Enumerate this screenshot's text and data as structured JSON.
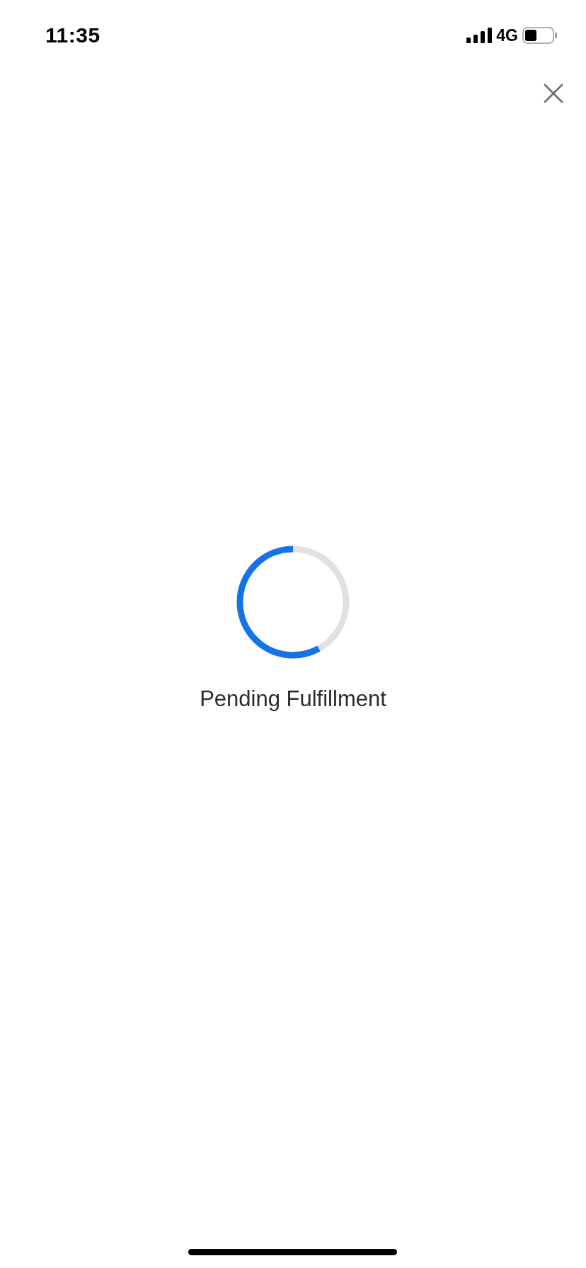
{
  "status_bar": {
    "time": "11:35",
    "network": "4G"
  },
  "loader": {
    "level": 0.58,
    "label": "Pending Fulfillment"
  }
}
